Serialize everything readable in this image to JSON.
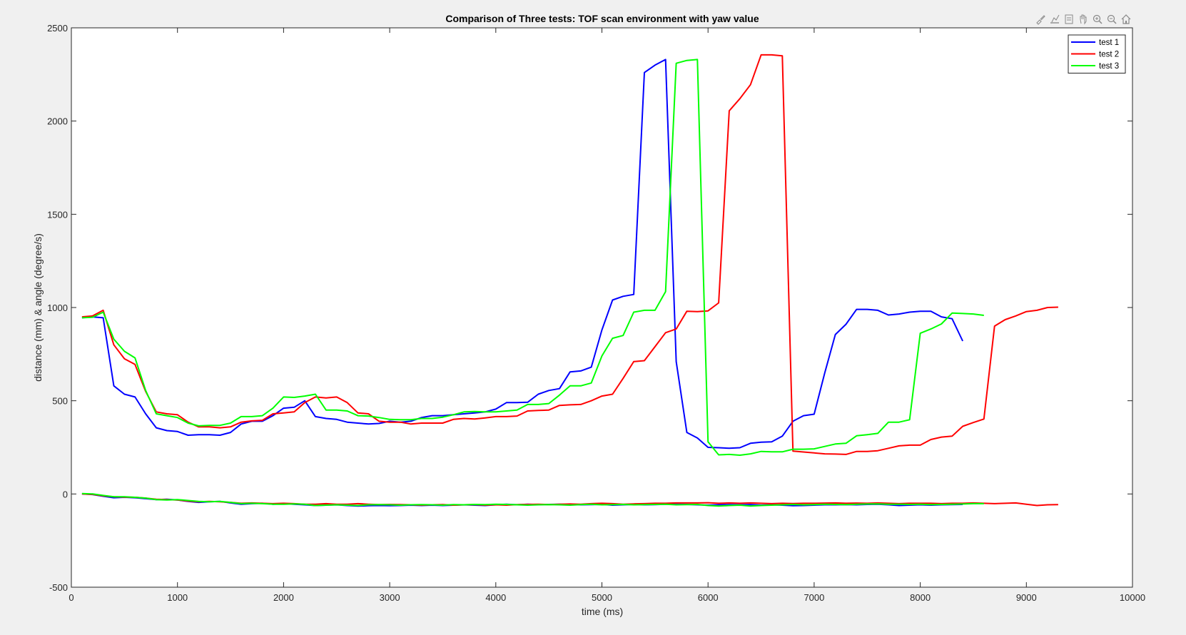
{
  "toolbar": {
    "icons": [
      "brush-icon",
      "data-tips-icon",
      "legend-toggle-icon",
      "pan-icon",
      "zoom-in-icon",
      "zoom-out-icon",
      "home-icon"
    ]
  },
  "chart_data": {
    "type": "line",
    "title": "Comparison of Three tests: TOF scan environment with yaw value",
    "xlabel": "time (ms)",
    "ylabel": "distance (mm) & angle (degree/s)",
    "xlim": [
      0,
      10000
    ],
    "ylim": [
      -500,
      2500
    ],
    "xticks": [
      0,
      1000,
      2000,
      3000,
      4000,
      5000,
      6000,
      7000,
      8000,
      9000,
      10000
    ],
    "yticks": [
      -500,
      0,
      500,
      1000,
      1500,
      2000,
      2500
    ],
    "legend_position": "top-right",
    "grid": false,
    "series": [
      {
        "name": "test 1",
        "color": "#0000ff",
        "x": [
          100,
          200,
          300,
          400,
          500,
          600,
          700,
          800,
          900,
          1000,
          1100,
          1200,
          1300,
          1400,
          1500,
          1600,
          1700,
          1800,
          1900,
          2000,
          2100,
          2200,
          2300,
          2400,
          2500,
          2600,
          2700,
          2800,
          2900,
          3000,
          3100,
          3200,
          3300,
          3400,
          3500,
          3600,
          3700,
          3800,
          3900,
          4000,
          4100,
          4200,
          4300,
          4400,
          4500,
          4600,
          4700,
          4800,
          4900,
          5000,
          5100,
          5200,
          5300,
          5400,
          5500,
          5600,
          5700,
          5800,
          5900,
          6000,
          6100,
          6200,
          6300,
          6400,
          6500,
          6600,
          6700,
          6800,
          6900,
          7000,
          7100,
          7200,
          7300,
          7400,
          7500,
          7600,
          7700,
          7800,
          7900,
          8000,
          8100,
          8200,
          8300,
          8400
        ],
        "y": [
          945,
          950,
          945,
          580,
          535,
          520,
          430,
          355,
          340,
          335,
          315,
          318,
          318,
          315,
          330,
          375,
          390,
          390,
          420,
          460,
          465,
          500,
          415,
          405,
          400,
          385,
          380,
          375,
          378,
          390,
          385,
          390,
          410,
          420,
          420,
          425,
          430,
          435,
          440,
          455,
          490,
          490,
          492,
          535,
          555,
          565,
          655,
          660,
          680,
          880,
          1040,
          1060,
          1070,
          2260,
          2300,
          2330,
          710,
          330,
          300,
          250,
          248,
          245,
          248,
          272,
          278,
          280,
          310,
          390,
          420,
          428,
          650,
          855,
          910,
          990,
          990,
          985,
          960,
          965,
          975,
          980,
          980,
          950,
          940,
          820
        ]
      },
      {
        "name": "test 2",
        "color": "#ff0000",
        "x": [
          100,
          200,
          300,
          400,
          500,
          600,
          700,
          800,
          900,
          1000,
          1100,
          1200,
          1300,
          1400,
          1500,
          1600,
          1700,
          1800,
          1900,
          2000,
          2100,
          2200,
          2300,
          2400,
          2500,
          2600,
          2700,
          2800,
          2900,
          3000,
          3100,
          3200,
          3300,
          3400,
          3500,
          3600,
          3700,
          3800,
          3900,
          4000,
          4100,
          4200,
          4300,
          4400,
          4500,
          4600,
          4700,
          4800,
          4900,
          5000,
          5100,
          5200,
          5300,
          5400,
          5500,
          5600,
          5700,
          5800,
          5900,
          6000,
          6100,
          6200,
          6300,
          6400,
          6500,
          6600,
          6700,
          6800,
          6900,
          7000,
          7100,
          7200,
          7300,
          7400,
          7500,
          7600,
          7700,
          7800,
          7900,
          8000,
          8100,
          8200,
          8300,
          8400,
          8500,
          8600,
          8700,
          8800,
          8900,
          9000,
          9100,
          9200,
          9300
        ],
        "y": [
          950,
          955,
          985,
          800,
          725,
          695,
          550,
          440,
          430,
          425,
          385,
          360,
          360,
          355,
          360,
          385,
          392,
          395,
          430,
          435,
          440,
          490,
          520,
          515,
          520,
          490,
          435,
          430,
          390,
          385,
          385,
          375,
          380,
          380,
          380,
          400,
          405,
          402,
          408,
          415,
          415,
          418,
          445,
          448,
          450,
          475,
          478,
          480,
          500,
          525,
          535,
          620,
          710,
          715,
          790,
          865,
          885,
          980,
          978,
          982,
          1025,
          2055,
          2120,
          2195,
          2355,
          2355,
          2350,
          230,
          225,
          220,
          215,
          214,
          212,
          228,
          228,
          232,
          245,
          258,
          262,
          262,
          292,
          305,
          310,
          363,
          383,
          402,
          900,
          935,
          955,
          978,
          985,
          1000,
          1002
        ]
      },
      {
        "name": "test 3",
        "color": "#00ff00",
        "x": [
          100,
          200,
          300,
          400,
          500,
          600,
          700,
          800,
          900,
          1000,
          1100,
          1200,
          1300,
          1400,
          1500,
          1600,
          1700,
          1800,
          1900,
          2000,
          2100,
          2200,
          2300,
          2400,
          2500,
          2600,
          2700,
          2800,
          2900,
          3000,
          3100,
          3200,
          3300,
          3400,
          3500,
          3600,
          3700,
          3800,
          3900,
          4000,
          4100,
          4200,
          4300,
          4400,
          4500,
          4600,
          4700,
          4800,
          4900,
          5000,
          5100,
          5200,
          5300,
          5400,
          5500,
          5600,
          5700,
          5800,
          5900,
          6000,
          6100,
          6200,
          6300,
          6400,
          6500,
          6600,
          6700,
          6800,
          6900,
          7000,
          7100,
          7200,
          7300,
          7400,
          7500,
          7600,
          7700,
          7800,
          7900,
          8000,
          8100,
          8200,
          8300,
          8400,
          8500,
          8600
        ],
        "y": [
          945,
          948,
          975,
          830,
          765,
          730,
          555,
          430,
          420,
          410,
          380,
          365,
          368,
          368,
          380,
          415,
          415,
          420,
          460,
          520,
          518,
          525,
          535,
          450,
          450,
          445,
          420,
          418,
          410,
          400,
          398,
          398,
          405,
          405,
          412,
          425,
          440,
          442,
          440,
          440,
          445,
          450,
          480,
          480,
          485,
          530,
          580,
          580,
          595,
          740,
          835,
          850,
          975,
          985,
          985,
          1085,
          2310,
          2325,
          2330,
          280,
          210,
          212,
          208,
          215,
          228,
          226,
          226,
          240,
          240,
          242,
          255,
          268,
          272,
          312,
          318,
          325,
          385,
          385,
          398,
          862,
          885,
          912,
          970,
          968,
          965,
          958
        ]
      },
      {
        "name": "",
        "color": "#0000ff",
        "x": [
          100,
          200,
          300,
          400,
          500,
          600,
          700,
          800,
          900,
          1000,
          1100,
          1200,
          1300,
          1400,
          1500,
          1600,
          1700,
          1800,
          1900,
          2000,
          2100,
          2200,
          2300,
          2400,
          2500,
          2600,
          2700,
          2800,
          2900,
          3000,
          3100,
          3200,
          3300,
          3400,
          3500,
          3600,
          3700,
          3800,
          3900,
          4000,
          4100,
          4200,
          4300,
          4400,
          4500,
          4600,
          4700,
          4800,
          4900,
          5000,
          5100,
          5200,
          5300,
          5400,
          5500,
          5600,
          5700,
          5800,
          5900,
          6000,
          6100,
          6200,
          6300,
          6400,
          6500,
          6600,
          6700,
          6800,
          6900,
          7000,
          7100,
          7200,
          7300,
          7400,
          7500,
          7600,
          7700,
          7800,
          7900,
          8000,
          8100,
          8200,
          8300,
          8400
        ],
        "y": [
          0,
          -3,
          -12,
          -20,
          -18,
          -20,
          -25,
          -30,
          -28,
          -32,
          -40,
          -45,
          -42,
          -40,
          -48,
          -55,
          -52,
          -50,
          -55,
          -52,
          -55,
          -58,
          -62,
          -60,
          -58,
          -62,
          -65,
          -63,
          -62,
          -63,
          -62,
          -60,
          -62,
          -60,
          -62,
          -60,
          -58,
          -60,
          -62,
          -58,
          -55,
          -58,
          -55,
          -57,
          -56,
          -55,
          -57,
          -58,
          -57,
          -56,
          -60,
          -58,
          -56,
          -58,
          -57,
          -55,
          -55,
          -56,
          -58,
          -60,
          -58,
          -57,
          -58,
          -57,
          -60,
          -58,
          -60,
          -63,
          -62,
          -60,
          -58,
          -58,
          -57,
          -58,
          -56,
          -55,
          -58,
          -62,
          -60,
          -58,
          -60,
          -58,
          -57,
          -56
        ]
      },
      {
        "name": "",
        "color": "#ff0000",
        "x": [
          100,
          200,
          300,
          400,
          500,
          600,
          700,
          800,
          900,
          1000,
          1100,
          1200,
          1300,
          1400,
          1500,
          1600,
          1700,
          1800,
          1900,
          2000,
          2100,
          2200,
          2300,
          2400,
          2500,
          2600,
          2700,
          2800,
          2900,
          3000,
          3100,
          3200,
          3300,
          3400,
          3500,
          3600,
          3700,
          3800,
          3900,
          4000,
          4100,
          4200,
          4300,
          4400,
          4500,
          4600,
          4700,
          4800,
          4900,
          5000,
          5100,
          5200,
          5300,
          5400,
          5500,
          5600,
          5700,
          5800,
          5900,
          6000,
          6100,
          6200,
          6300,
          6400,
          6500,
          6600,
          6700,
          6800,
          6900,
          7000,
          7100,
          7200,
          7300,
          7400,
          7500,
          7600,
          7700,
          7800,
          7900,
          8000,
          8100,
          8200,
          8300,
          8400,
          8500,
          8600,
          8700,
          8800,
          8900,
          9000,
          9100,
          9200,
          9300
        ],
        "y": [
          0,
          -2,
          -10,
          -15,
          -17,
          -18,
          -22,
          -28,
          -30,
          -32,
          -38,
          -42,
          -40,
          -42,
          -45,
          -50,
          -48,
          -50,
          -52,
          -50,
          -52,
          -55,
          -55,
          -52,
          -55,
          -55,
          -52,
          -55,
          -57,
          -56,
          -57,
          -58,
          -60,
          -58,
          -57,
          -60,
          -58,
          -57,
          -60,
          -58,
          -60,
          -57,
          -56,
          -55,
          -57,
          -55,
          -54,
          -55,
          -52,
          -50,
          -52,
          -55,
          -53,
          -52,
          -50,
          -50,
          -48,
          -48,
          -48,
          -47,
          -50,
          -48,
          -50,
          -48,
          -50,
          -52,
          -50,
          -51,
          -50,
          -50,
          -49,
          -48,
          -50,
          -49,
          -50,
          -48,
          -50,
          -52,
          -50,
          -50,
          -50,
          -52,
          -50,
          -50,
          -48,
          -50,
          -52,
          -50,
          -48,
          -55,
          -62,
          -58,
          -57
        ]
      },
      {
        "name": "",
        "color": "#00ff00",
        "x": [
          100,
          200,
          300,
          400,
          500,
          600,
          700,
          800,
          900,
          1000,
          1100,
          1200,
          1300,
          1400,
          1500,
          1600,
          1700,
          1800,
          1900,
          2000,
          2100,
          2200,
          2300,
          2400,
          2500,
          2600,
          2700,
          2800,
          2900,
          3000,
          3100,
          3200,
          3300,
          3400,
          3500,
          3600,
          3700,
          3800,
          3900,
          4000,
          4100,
          4200,
          4300,
          4400,
          4500,
          4600,
          4700,
          4800,
          4900,
          5000,
          5100,
          5200,
          5300,
          5400,
          5500,
          5600,
          5700,
          5800,
          5900,
          6000,
          6100,
          6200,
          6300,
          6400,
          6500,
          6600,
          6700,
          6800,
          6900,
          7000,
          7100,
          7200,
          7300,
          7400,
          7500,
          7600,
          7700,
          7800,
          7900,
          8000,
          8100,
          8200,
          8300,
          8400,
          8500,
          8600
        ],
        "y": [
          2,
          0,
          -8,
          -15,
          -15,
          -18,
          -22,
          -30,
          -32,
          -30,
          -35,
          -40,
          -42,
          -40,
          -45,
          -52,
          -50,
          -52,
          -55,
          -55,
          -53,
          -55,
          -62,
          -60,
          -58,
          -60,
          -62,
          -58,
          -57,
          -58,
          -60,
          -58,
          -57,
          -58,
          -60,
          -57,
          -58,
          -56,
          -57,
          -55,
          -56,
          -58,
          -60,
          -58,
          -57,
          -58,
          -60,
          -57,
          -55,
          -58,
          -57,
          -56,
          -58,
          -57,
          -56,
          -55,
          -58,
          -57,
          -56,
          -62,
          -65,
          -62,
          -60,
          -65,
          -62,
          -60,
          -58,
          -56,
          -58,
          -57,
          -55,
          -56,
          -57,
          -55,
          -54,
          -53,
          -55,
          -55,
          -56,
          -55,
          -57,
          -56,
          -55,
          -54,
          -52,
          -52
        ]
      }
    ]
  }
}
